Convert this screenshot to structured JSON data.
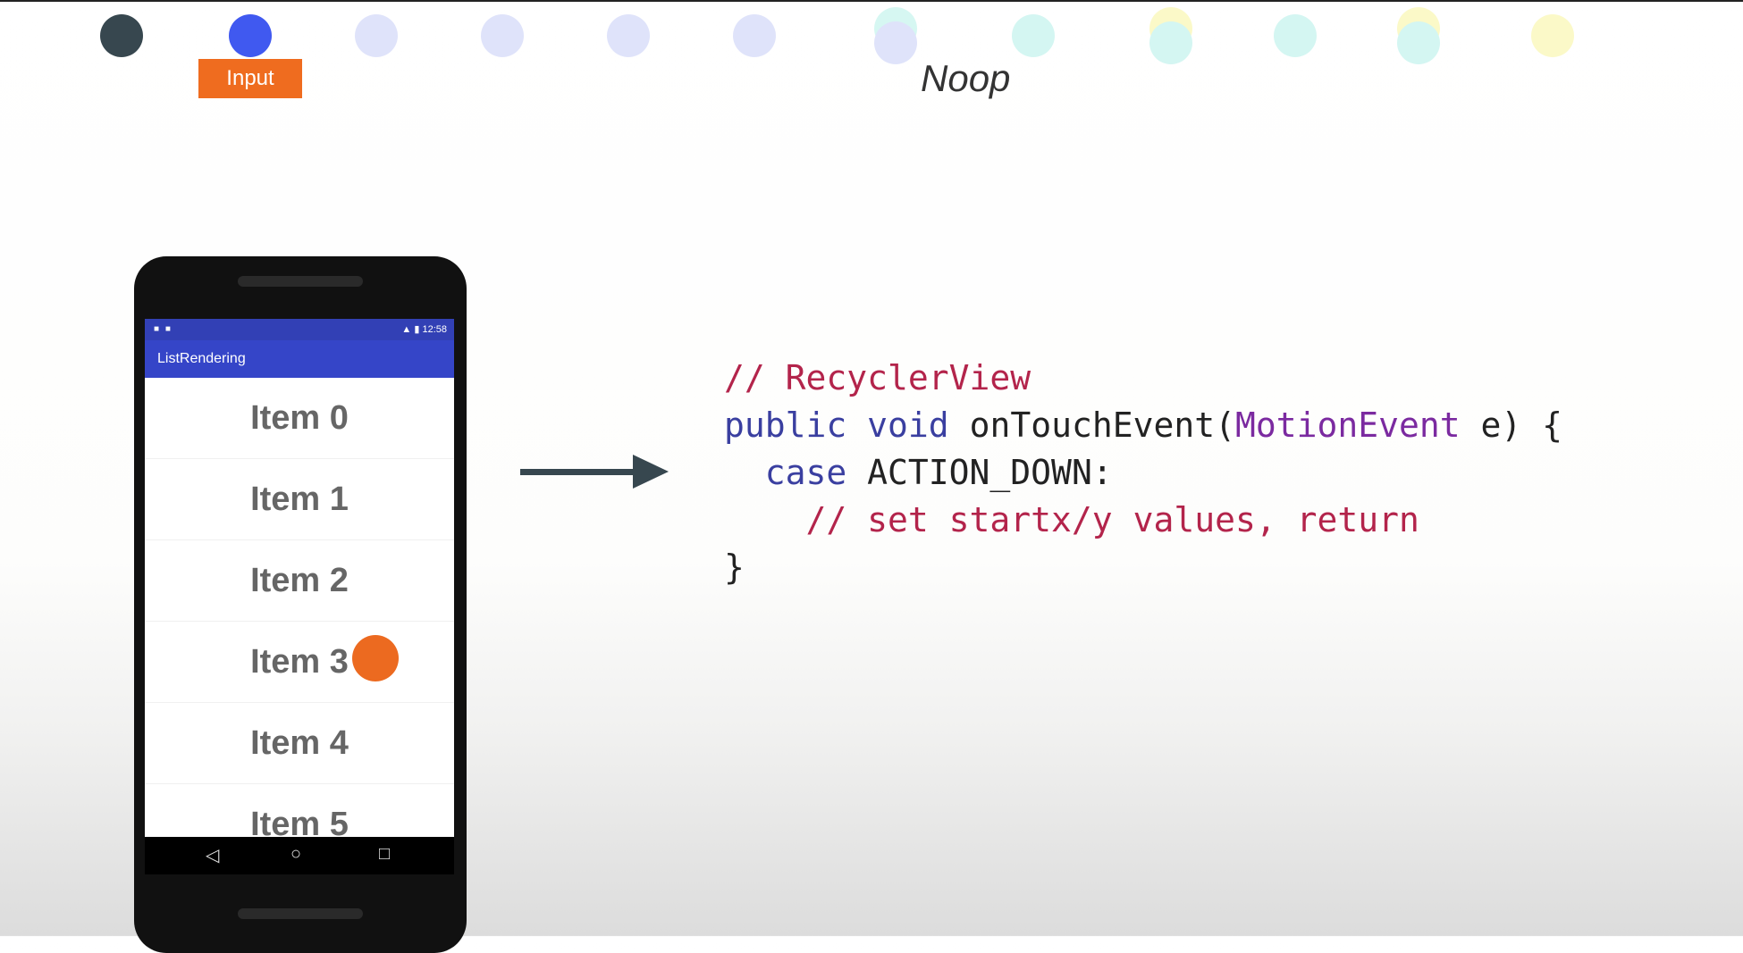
{
  "timeline": {
    "input_label": "Input",
    "stage_title": "Noop"
  },
  "phone": {
    "status_time": "12:58",
    "app_title": "ListRendering",
    "items": [
      "Item 0",
      "Item 1",
      "Item 2",
      "Item 3",
      "Item 4",
      "Item 5"
    ]
  },
  "code": {
    "line1": "// RecyclerView",
    "line2_kw1": "public",
    "line2_kw2": "void",
    "line2_fn": "onTouchEvent(",
    "line2_type": "MotionEvent",
    "line2_rest": " e) {",
    "line3_kw": "case",
    "line3_rest": " ACTION_DOWN:",
    "line4": "// set startx/y values, return",
    "line5": "}"
  },
  "colors": {
    "accent_orange": "#ef6c1f",
    "active_dot": "#4059f0",
    "comment": "#b3244b",
    "keyword": "#3a3fa0",
    "type": "#7b2aa0"
  }
}
